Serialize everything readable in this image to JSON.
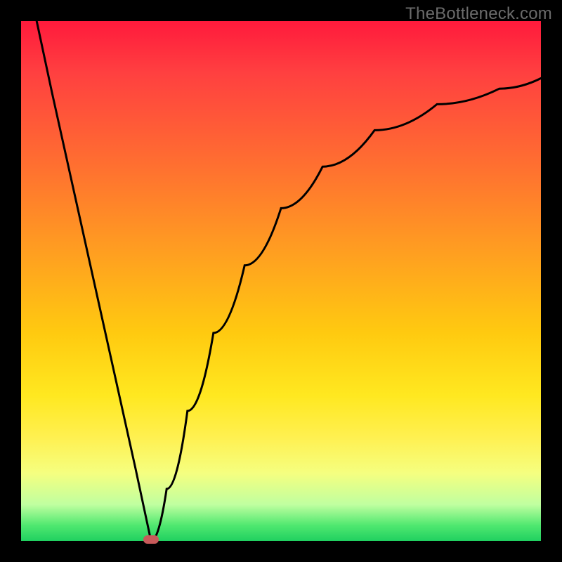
{
  "watermark": "TheBottleneck.com",
  "chart_data": {
    "type": "line",
    "title": "",
    "xlabel": "",
    "ylabel": "",
    "xlim": [
      0,
      100
    ],
    "ylim": [
      0,
      100
    ],
    "grid": false,
    "series": [
      {
        "name": "left-branch",
        "x": [
          3,
          6,
          10,
          14,
          18,
          22,
          25
        ],
        "y": [
          100,
          86,
          68,
          50,
          32,
          14,
          0
        ]
      },
      {
        "name": "right-branch",
        "x": [
          25,
          28,
          32,
          37,
          43,
          50,
          58,
          68,
          80,
          92,
          100
        ],
        "y": [
          0,
          10,
          25,
          40,
          53,
          64,
          72,
          79,
          84,
          87,
          89
        ]
      }
    ],
    "minimum_point": {
      "x": 25,
      "y": 0
    },
    "background_gradient": {
      "top_color": "#ff1a3c",
      "bottom_color": "#20d060",
      "meaning": "red-high to green-low scale"
    },
    "marker": {
      "color": "#c85a5a",
      "shape": "rounded-rect"
    }
  }
}
